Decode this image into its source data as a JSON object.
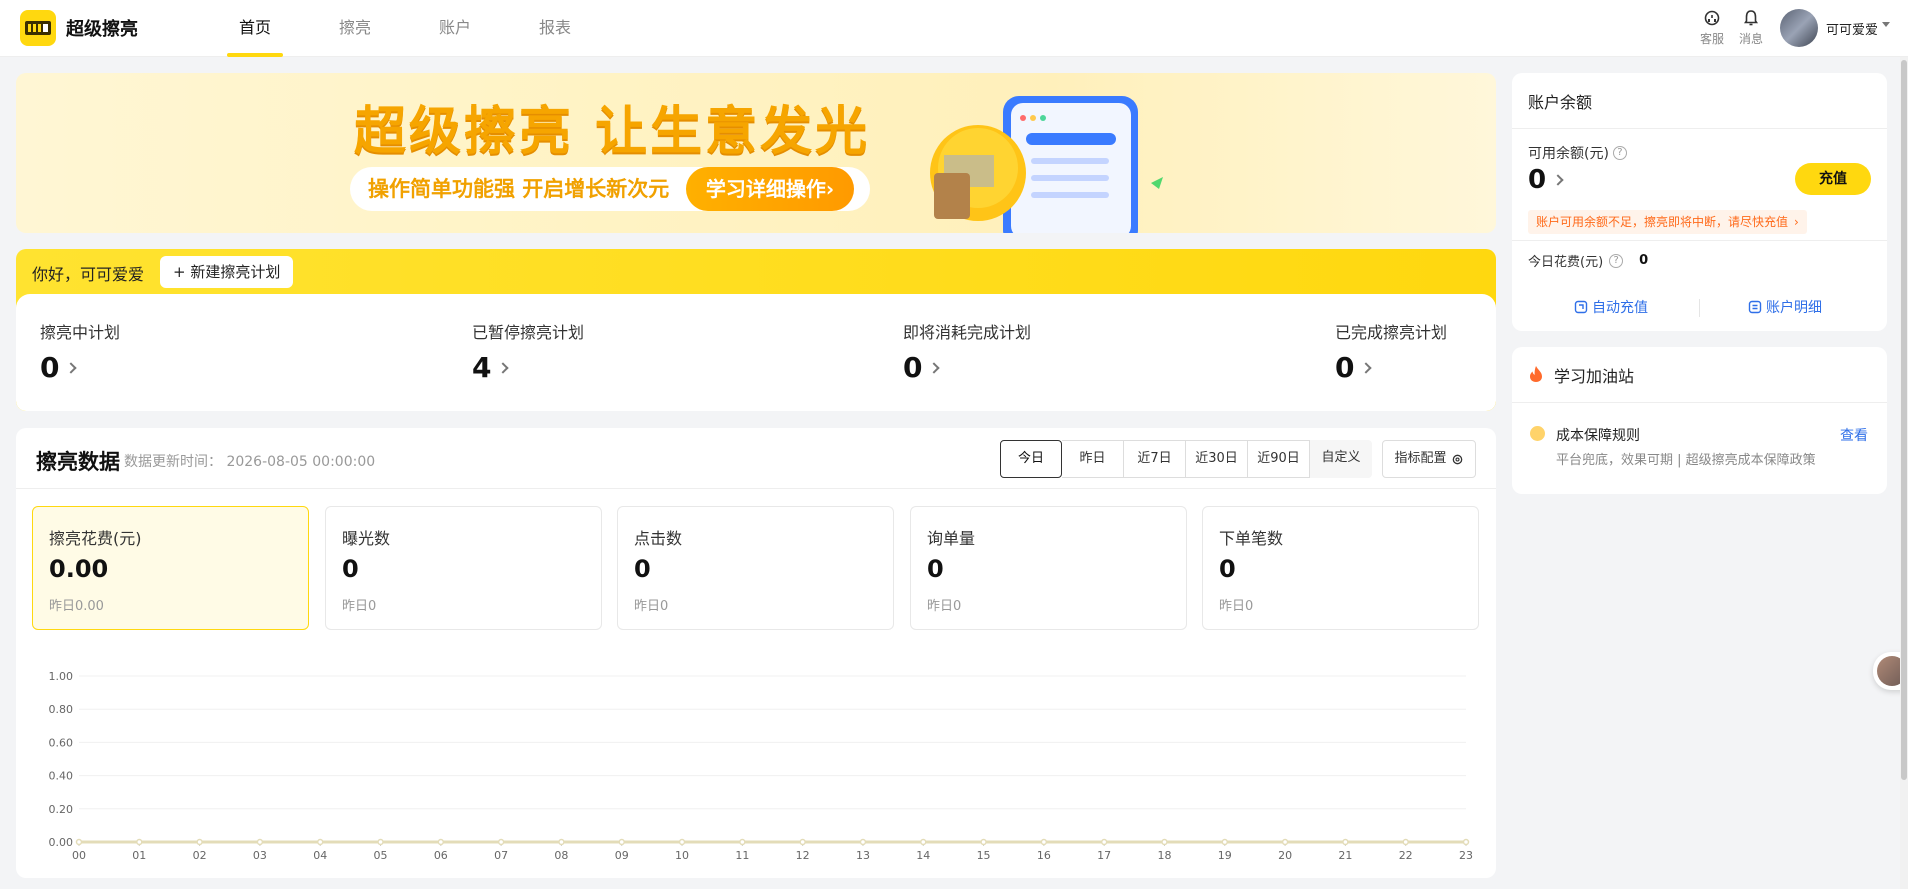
{
  "app": {
    "name": "超级擦亮"
  },
  "nav": {
    "tabs": [
      {
        "label": "首页"
      },
      {
        "label": "擦亮"
      },
      {
        "label": "账户"
      },
      {
        "label": "报表"
      }
    ],
    "active_tab": "首页"
  },
  "header": {
    "service_label": "客服",
    "message_label": "消息",
    "user_name": "可可爱爱"
  },
  "banner": {
    "title": "超级擦亮 让生意发光",
    "subtitle": "操作简单功能强 开启增长新次元",
    "cta": "学习详细操作›"
  },
  "greeting": {
    "text": "你好，可可爱爱",
    "new_plan_button": "+ 新建擦亮计划"
  },
  "plan_stats": [
    {
      "label": "擦亮中计划",
      "value": "0"
    },
    {
      "label": "已暂停擦亮计划",
      "value": "4"
    },
    {
      "label": "即将消耗完成计划",
      "value": "0"
    },
    {
      "label": "已完成擦亮计划",
      "value": "0"
    }
  ],
  "data_panel": {
    "title": "擦亮数据",
    "update_time": "数据更新时间：  2026-08-05 00:00:00",
    "ranges": [
      "今日",
      "昨日",
      "近7日",
      "近30日",
      "近90日",
      "自定义"
    ],
    "active_range": "今日",
    "config_button": "指标配置",
    "metrics": [
      {
        "label": "擦亮花费(元)",
        "value": "0.00",
        "prev": "昨日0.00",
        "active": true
      },
      {
        "label": "曝光数",
        "value": "0",
        "prev": "昨日0",
        "active": false
      },
      {
        "label": "点击数",
        "value": "0",
        "prev": "昨日0",
        "active": false
      },
      {
        "label": "询单量",
        "value": "0",
        "prev": "昨日0",
        "active": false
      },
      {
        "label": "下单笔数",
        "value": "0",
        "prev": "昨日0",
        "active": false
      }
    ]
  },
  "chart_data": {
    "type": "line",
    "x": [
      "00",
      "01",
      "02",
      "03",
      "04",
      "05",
      "06",
      "07",
      "08",
      "09",
      "10",
      "11",
      "12",
      "13",
      "14",
      "15",
      "16",
      "17",
      "18",
      "19",
      "20",
      "21",
      "22",
      "23"
    ],
    "series": [
      {
        "values": [
          0,
          0,
          0,
          0,
          0,
          0,
          0,
          0,
          0,
          0,
          0,
          0,
          0,
          0,
          0,
          0,
          0,
          0,
          0,
          0,
          0,
          0,
          0,
          0
        ]
      }
    ],
    "ylim": [
      0,
      1
    ],
    "yticks": [
      "0.00",
      "0.20",
      "0.40",
      "0.60",
      "0.80",
      "1.00"
    ],
    "line_color": "#e3dcb8",
    "grid": true
  },
  "account": {
    "title": "账户余额",
    "available_label": "可用余额(元)",
    "available_value": "0",
    "recharge_button": "充值",
    "warning": "账户可用余额不足，擦亮即将中断，请尽快充值",
    "today_cost_label": "今日花费(元)",
    "today_cost_value": "0",
    "auto_recharge": "自动充值",
    "account_detail": "账户明细"
  },
  "learning": {
    "title": "学习加油站",
    "item_title": "成本保障规则",
    "item_desc": "平台兜底，效果可期 | 超级擦亮成本保障政策",
    "view_link": "查看"
  },
  "colors": {
    "brand_yellow": "#ffd80f",
    "link_blue": "#2f6fe8",
    "warning_orange": "#ff6a1a"
  }
}
